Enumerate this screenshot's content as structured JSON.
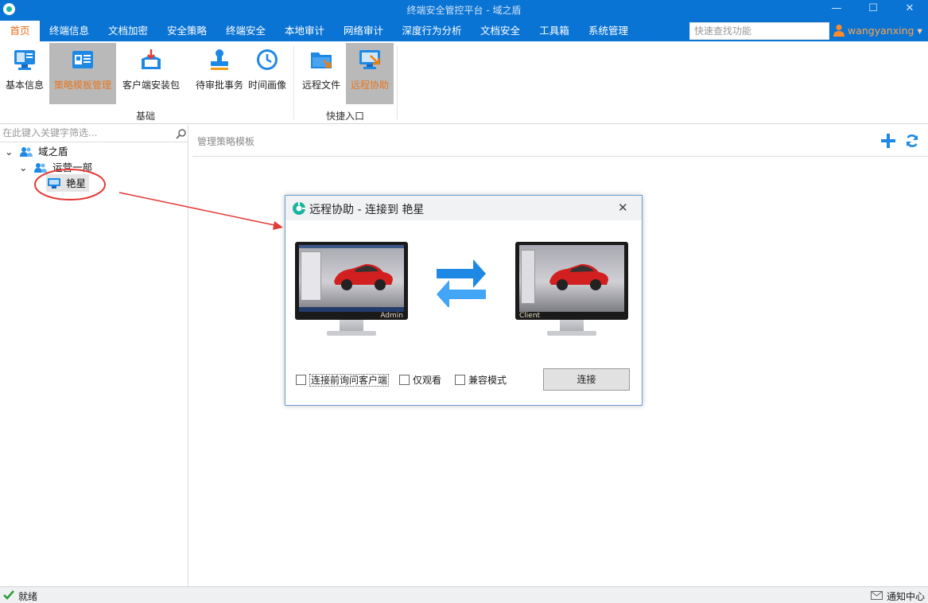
{
  "window": {
    "title": "终端安全管控平台 - 域之盾",
    "minimize": "—",
    "maximize": "☐",
    "close": "✕"
  },
  "menu": {
    "tabs": [
      "首页",
      "终端信息",
      "文档加密",
      "安全策略",
      "终端安全",
      "本地审计",
      "网络审计",
      "深度行为分析",
      "文档安全",
      "工具箱",
      "系统管理"
    ],
    "search_placeholder": "快速查找功能",
    "user": "wangyanxing",
    "user_arrow": "▾"
  },
  "ribbon": {
    "buttons": [
      "基本信息",
      "策略模板管理",
      "客户端安装包",
      "待审批事务",
      "时间画像",
      "远程文件",
      "远程协助"
    ],
    "groups": [
      "基础",
      "快捷入口"
    ]
  },
  "left_panel": {
    "filter_placeholder": "在此键入关键字筛选...",
    "tree": {
      "root": "域之盾",
      "dept": "运营一部",
      "computer": "艳星"
    }
  },
  "main": {
    "header": "管理策略模板"
  },
  "dialog": {
    "title": "远程协助 - 连接到 艳星",
    "close": "✕",
    "admin_label": "Admin",
    "client_label": "Client",
    "options": [
      "连接前询问客户端",
      "仅观看",
      "兼容模式"
    ],
    "connect_button": "连接"
  },
  "status": {
    "ready": "就绪",
    "notify": "通知中心"
  },
  "colors": {
    "brand_blue": "#0a74d4",
    "active_orange": "#e86b1a",
    "annotation_red": "#e53935"
  }
}
